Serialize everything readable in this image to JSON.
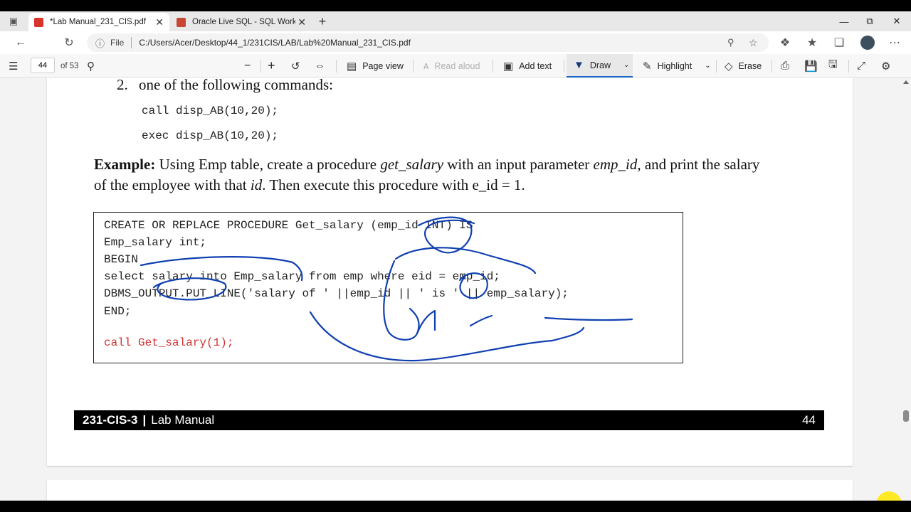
{
  "browser": {
    "tabs": [
      {
        "title": "*Lab Manual_231_CIS.pdf",
        "active": true
      },
      {
        "title": "Oracle Live SQL - SQL Workshee",
        "active": false
      }
    ],
    "new_tab": "+",
    "address": {
      "scheme_label": "File",
      "url": "C:/Users/Acer/Desktop/44_1/231CIS/LAB/Lab%20Manual_231_CIS.pdf"
    }
  },
  "pdf_toolbar": {
    "page_number": "44",
    "page_total": "of 53",
    "zoom_out": "−",
    "zoom_in": "+",
    "page_view": "Page view",
    "read_aloud": "Read aloud",
    "add_text": "Add text",
    "draw": "Draw",
    "highlight": "Highlight",
    "erase": "Erase"
  },
  "document": {
    "list_item_number": "2.",
    "list_item_text": "one of the following commands:",
    "command_call": "call disp_AB(10,20);",
    "command_exec": "exec disp_AB(10,20);",
    "example_label": "Example:",
    "example_p1": " Using Emp table, create a procedure ",
    "example_i1": "get_salary",
    "example_p2": " with an input parameter ",
    "example_i2": "emp_id",
    "example_p3": ", and print the salary",
    "example_p4": "of the employee with that ",
    "example_i3": "id",
    "example_p5": ". Then execute this procedure with e_id = 1.",
    "code_lines": [
      "CREATE OR REPLACE PROCEDURE Get_salary (emp_id INT) IS",
      "Emp_salary int;",
      "BEGIN",
      "select salary into Emp_salary from emp where eid = emp_id;",
      "DBMS_OUTPUT.PUT_LINE('salary of ' ||emp_id || ' is ' || emp_salary);",
      "END;"
    ],
    "code_call": "call Get_salary(1);",
    "footer_course": "231-CIS-3",
    "footer_divider": "|",
    "footer_title": "Lab Manual",
    "footer_page": "44"
  },
  "colors": {
    "ink": "#1040b0",
    "code_call": "#d03030",
    "footer_bg": "#000000",
    "pdf_favicon": "#d9342b",
    "oracle_favicon": "#c74634"
  }
}
